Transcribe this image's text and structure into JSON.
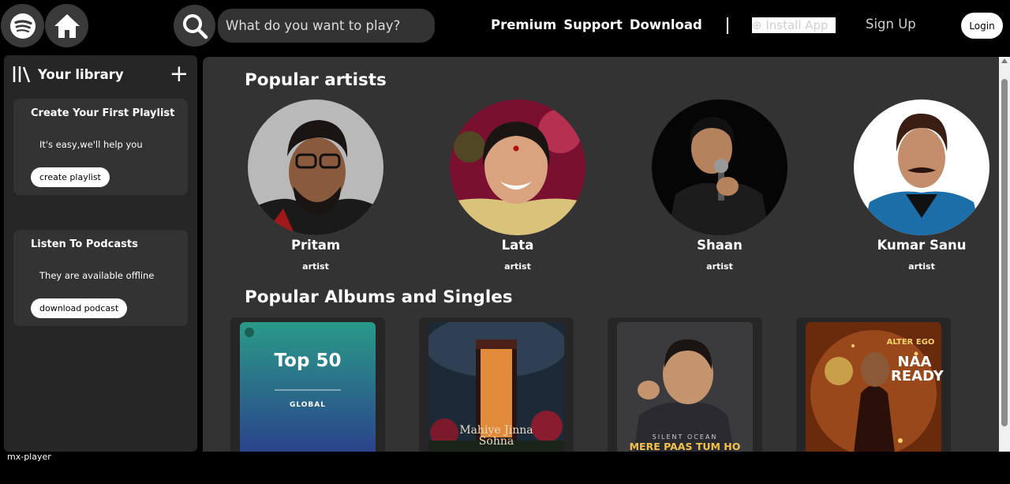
{
  "nav": {
    "search_placeholder": "What do you want to play?",
    "links": [
      "Premium",
      "Support",
      "Download"
    ],
    "install_label": "Install App",
    "signup_label": "Sign Up",
    "login_label": "Login"
  },
  "sidebar": {
    "title": "Your library",
    "cards": [
      {
        "title": "Create Your First Playlist",
        "text": "It's easy,we'll help you",
        "button": "create playlist"
      },
      {
        "title": "Listen To Podcasts",
        "text": "They are available offline",
        "button": "download podcast"
      }
    ]
  },
  "main": {
    "artists_title": "Popular artists",
    "artists": [
      {
        "name": "Pritam",
        "role": "artist"
      },
      {
        "name": "Lata",
        "role": "artist"
      },
      {
        "name": "Shaan",
        "role": "artist"
      },
      {
        "name": "Kumar Sanu",
        "role": "artist"
      }
    ],
    "albums_title": "Popular Albums and Singles",
    "albums": [
      {
        "title": "Top 50",
        "subtitle": "GLOBAL"
      },
      {
        "title": "Mahiye Jinna Sohna"
      },
      {
        "title": "MERE PAAS TUM HO",
        "subtitle": "SILENT OCEAN"
      },
      {
        "title": "NAA READY",
        "subtitle": "ALTER EGO"
      }
    ]
  },
  "player": {
    "label": "mx-player"
  },
  "colors": {
    "background": "#000000",
    "panel": "#262626",
    "main": "#333333",
    "accent": "#1db954"
  }
}
